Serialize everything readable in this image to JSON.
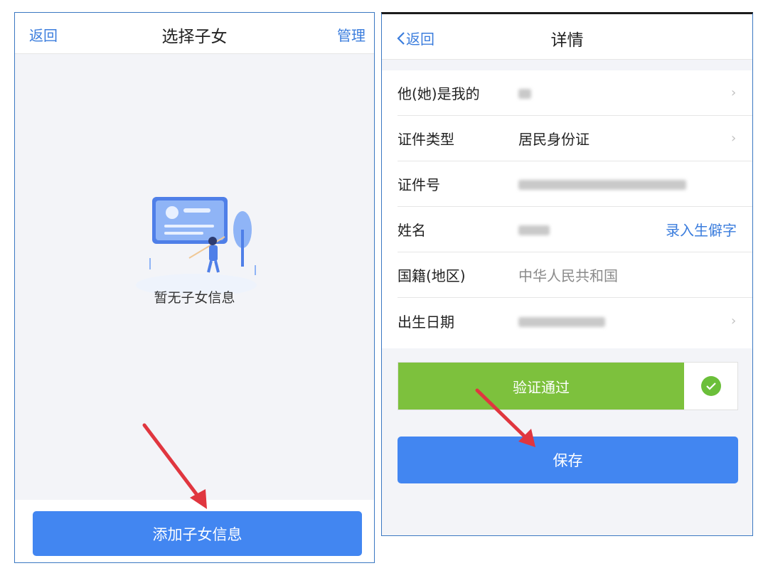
{
  "colors": {
    "accent": "#3b7ddd",
    "primary_button": "#4286f1",
    "verify_green": "#7dc13d",
    "arrow_red": "#e0363f",
    "frame_border": "#3b78c2"
  },
  "left_screen": {
    "navbar": {
      "back_label": "返回",
      "title": "选择子女",
      "right_label": "管理"
    },
    "empty_state": {
      "icon": "empty-illustration-icon",
      "text": "暂无子女信息"
    },
    "add_button_label": "添加子女信息"
  },
  "right_screen": {
    "navbar": {
      "back_icon": "chevron-left-icon",
      "back_label": "返回",
      "title": "详情"
    },
    "form": {
      "relation_label": "他(她)是我的",
      "id_type_label": "证件类型",
      "id_type_value": "居民身份证",
      "id_number_label": "证件号",
      "name_label": "姓名",
      "rare_char_link": "录入生僻字",
      "nationality_label": "国籍(地区)",
      "nationality_value": "中华人民共和国",
      "birth_label": "出生日期"
    },
    "verify_label": "验证通过",
    "verify_icon": "check-circle-icon",
    "save_button_label": "保存"
  }
}
